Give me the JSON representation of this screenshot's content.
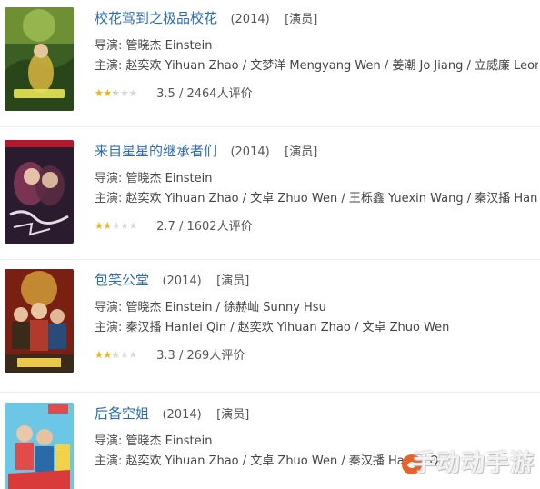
{
  "movies": [
    {
      "title": "校花驾到之极品校花",
      "year": "(2014)",
      "role": "[演员]",
      "director_label": "导演:",
      "directors": "管晓杰 Einstein",
      "cast_label": "主演:",
      "cast": "赵奕欢 Yihuan Zhao / 文梦洋 Mengyang Wen / 姜潮 Jo Jiang / 立威廉 Leon J...",
      "score": "3.5",
      "ratings": "2464人评价",
      "star_fill": 0.4,
      "poster_colors": [
        "#3a5e23",
        "#a7c45a",
        "#d9b541"
      ]
    },
    {
      "title": "来自星星的继承者们",
      "year": "(2014)",
      "role": "[演员]",
      "director_label": "导演:",
      "directors": "管晓杰 Einstein",
      "cast_label": "主演:",
      "cast": "赵奕欢 Yihuan Zhao / 文卓 Zhuo Wen / 王栎鑫 Yuexin Wang / 秦汉播 Hanlei ...",
      "score": "2.7",
      "ratings": "1602人评价",
      "star_fill": 0.3,
      "poster_colors": [
        "#2b1b2e",
        "#8d3a5d",
        "#e8d9e4"
      ]
    },
    {
      "title": "包笑公堂",
      "year": "(2014)",
      "role": "[演员]",
      "director_label": "导演:",
      "directors": "管晓杰 Einstein / 徐赫屾 Sunny Hsu",
      "cast_label": "主演:",
      "cast": "秦汉播 Hanlei Qin / 赵奕欢 Yihuan Zhao / 文卓 Zhuo Wen",
      "score": "3.3",
      "ratings": "269人评价",
      "star_fill": 0.4,
      "poster_colors": [
        "#7a1f14",
        "#d6a23a",
        "#3a2a1a"
      ]
    },
    {
      "title": "后备空姐",
      "year": "(2014)",
      "role": "[演员]",
      "director_label": "导演:",
      "directors": "管晓杰 Einstein",
      "cast_label": "主演:",
      "cast": "赵奕欢 Yihuan Zhao / 文卓 Zhuo Wen / 秦汉播 Hanlei Qin / 文...",
      "score": "",
      "ratings": "",
      "star_fill": 0,
      "poster_colors": [
        "#6cc6e6",
        "#e34a4a",
        "#f2d24a"
      ]
    }
  ],
  "watermark": "手动动手游",
  "colors": {
    "title_link": "#2b6cb2",
    "star": "#f5b21b",
    "star_empty": "#d9d9d9"
  }
}
